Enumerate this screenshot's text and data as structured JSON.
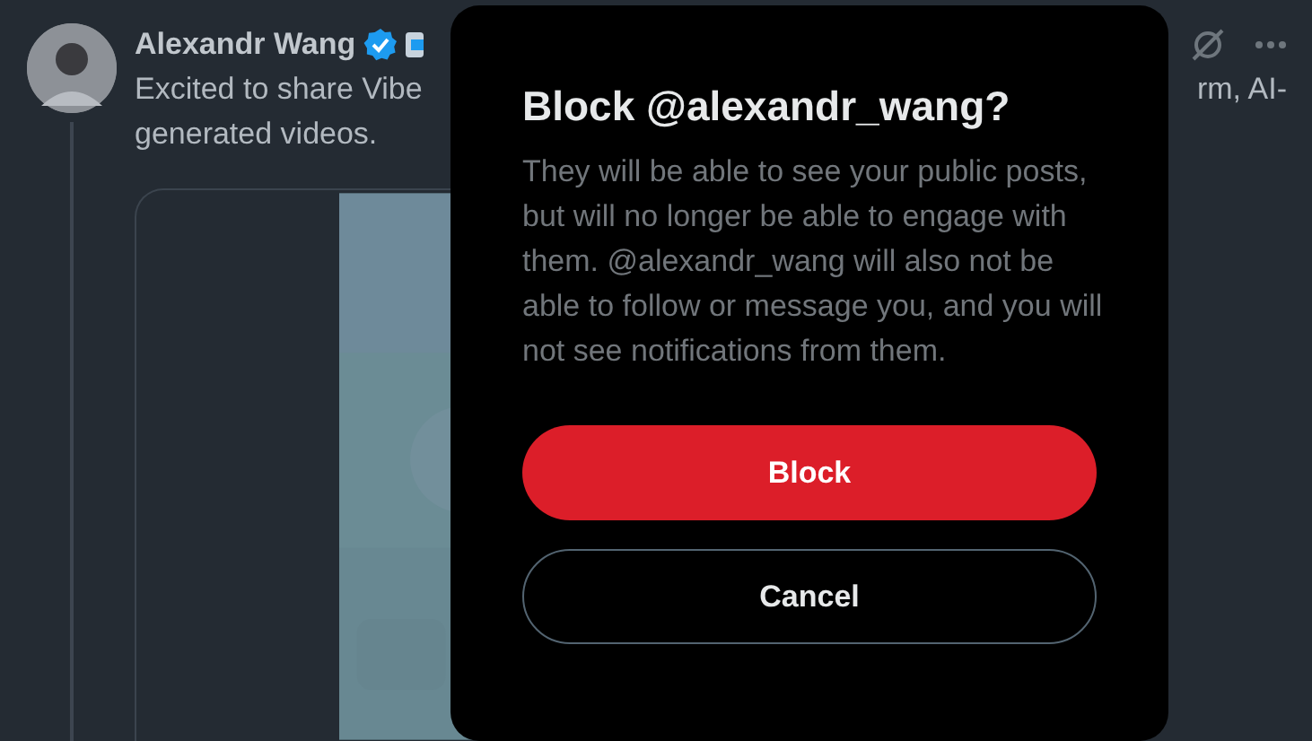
{
  "post": {
    "author": "Alexandr Wang",
    "verified": true,
    "text_left": "Excited to share Vibe",
    "text_right": "rm, AI-",
    "text_line2": "generated videos."
  },
  "dialog": {
    "title": "Block @alexandr_wang?",
    "body": "They will be able to see your public posts, but will no longer be able to engage with them. @alexandr_wang will also not be able to follow or message you, and you will not see notifications from them.",
    "buttons": [
      {
        "label": "Block",
        "kind": "danger"
      },
      {
        "label": "Cancel",
        "kind": "outline"
      }
    ]
  }
}
